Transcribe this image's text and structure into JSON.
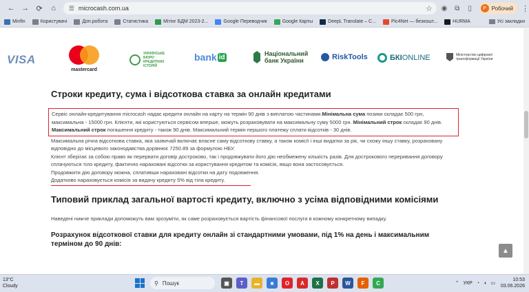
{
  "browser": {
    "url": "microcash.com.ua",
    "profile_label": "Робочий",
    "profile_initial": "Р"
  },
  "bookmarks": [
    {
      "label": "Minfin",
      "color": "#3a6fb0"
    },
    {
      "label": "Користувачі",
      "color": "#7a7f88"
    },
    {
      "label": "Доп.робота",
      "color": "#7a7f88"
    },
    {
      "label": "Статистика",
      "color": "#7a7f88"
    },
    {
      "label": "Мітінг БДМ 2023-2...",
      "color": "#2e9b4a"
    },
    {
      "label": "Google Переводчик",
      "color": "#4285f4"
    },
    {
      "label": "Google Карты",
      "color": "#34a853"
    },
    {
      "label": "DeepL Translate – С...",
      "color": "#0f2b46"
    },
    {
      "label": "Pic4Net — безкошт...",
      "color": "#e24a2a"
    },
    {
      "label": "HURMA",
      "color": "#1a1a1a"
    }
  ],
  "bookmarks_right": "Усі закладки",
  "logos": {
    "visa": "VISA",
    "mastercard": "mastercard",
    "ubki": "УКРАЇНСЬКЕ БЮРО КРЕДИТНИХ ІСТОРІЙ",
    "bankid_text": "bank",
    "bankid_badge": "id",
    "nbu_line1": "Національний",
    "nbu_line2": "банк України",
    "risktools": "RiskTools",
    "bki_bold": "БКІ",
    "bki_light": "ONLINE",
    "ministry": "Міністерство цифрової трансформації України"
  },
  "content": {
    "heading1": "Строки кредиту, сума і відсоткова ставка за онлайн кредитами",
    "box_intro": "Сервіс онлайн-кредитування microcash надає кредити онлайн на карту на термін 90 днів з виплатою частинами.",
    "min_sum_label": "Мінімальна сума",
    "min_sum_text": " позики складає 500 грн, максимальна - 15000 грн. Клієнти, які користуються сервісом вперше, можуть розраховувати на максимальну суму 5000 грн. ",
    "min_term_label": "Мінімальний строк",
    "min_term_text": " складає 90 днів. ",
    "max_term_label": "Максимальний строк",
    "max_term_text": " погашення кредиту - також 90 днів. Максимальний термін першого платежу сплати відсотків - 30 днів.",
    "para1": "Максимальна річна відсоткова ставка, яка зазвичай включає власне саму відсоткову ставку, а також комісії і інші видатки за рік, чи схожу іншу ставку, розраховану відповідно до місцевого законодавства дорівнює 7250.89 за формулою НБУ.",
    "para2": "Клієнт зберігає за собою право як перервати договір достроково, так і продовжувати його дію необмежену кількість разів. Для дострокового переривання договору сплачуються тіло кредиту, фактично нараховані відсотки за користування кредитом та комісія, якщо вона застосовується.",
    "para3": "Продовжити дію договору можна, сплативши нараховані відсотки на дату подовження.",
    "para4": "Додатково нараховується комісія за видачу кредиту 5% від тіла кредиту.",
    "heading2": "Типовий приклад загальної вартості кредиту, включно з усіма відповідними комісіями",
    "intro": "Наведені нижче приклади допоможуть вам зрозуміти, як саме розраховується вартість фінансової послуги в кожному конкретному випадку.",
    "heading3": "Розрахунок відсоткової ставки для кредиту онлайн зі стандартними умовами, під 1% на день і максимальним терміном до 90 днів:"
  },
  "scroll_top_glyph": "▲",
  "taskbar": {
    "temp": "13°C",
    "weather": "Cloudy",
    "search_placeholder": "Пошук",
    "lang": "УКР",
    "time": "10:53",
    "date": "03.06.2026",
    "apps": [
      {
        "name": "task-view",
        "color": "#555555",
        "glyph": "▣"
      },
      {
        "name": "teams",
        "color": "#5b5fc7",
        "glyph": "T"
      },
      {
        "name": "file-explorer",
        "color": "#e8b32a",
        "glyph": "▬"
      },
      {
        "name": "store",
        "color": "#3a7bd5",
        "glyph": "■"
      },
      {
        "name": "opera",
        "color": "#e0232a",
        "glyph": "O"
      },
      {
        "name": "acrobat",
        "color": "#d82a2a",
        "glyph": "A"
      },
      {
        "name": "excel",
        "color": "#1e7145",
        "glyph": "X"
      },
      {
        "name": "pdf-app",
        "color": "#c03030",
        "glyph": "P"
      },
      {
        "name": "word",
        "color": "#2b579a",
        "glyph": "W"
      },
      {
        "name": "firefox",
        "color": "#e66000",
        "glyph": "F"
      },
      {
        "name": "chrome",
        "color": "#34a853",
        "glyph": "C"
      }
    ]
  }
}
